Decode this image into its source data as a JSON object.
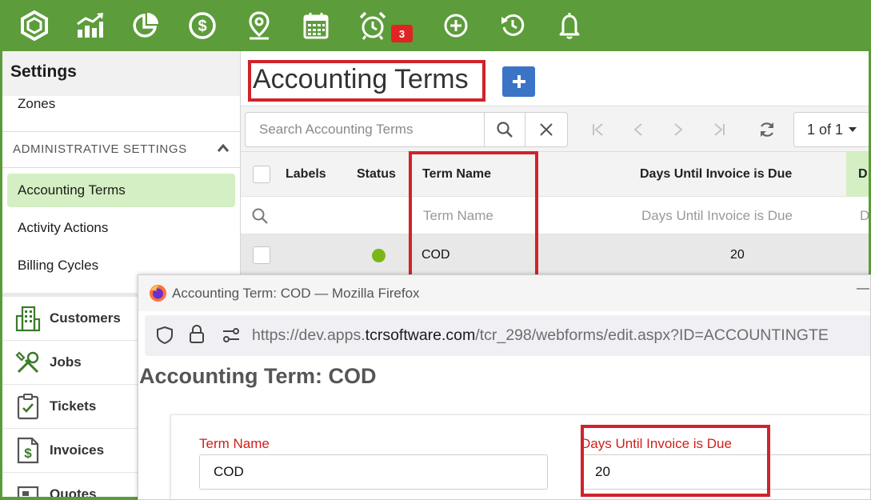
{
  "topbar": {
    "icons": [
      "app-logo-icon",
      "chart-icon",
      "pie-chart-icon",
      "dollar-icon",
      "map-pin-icon",
      "calendar-icon",
      "alarm-clock-icon",
      "add-circle-icon",
      "history-icon",
      "bell-icon"
    ],
    "alarm_badge": "3",
    "color": "#5c9c3a"
  },
  "sidebar": {
    "title": "Settings",
    "zones_label": "Zones",
    "section_label": "ADMINISTRATIVE SETTINGS",
    "items": [
      {
        "label": "Accounting Terms",
        "active": true
      },
      {
        "label": "Activity Actions",
        "active": false
      },
      {
        "label": "Billing Cycles",
        "active": false
      }
    ],
    "nav": [
      {
        "label": "Customers",
        "icon": "building-icon"
      },
      {
        "label": "Jobs",
        "icon": "tools-icon"
      },
      {
        "label": "Tickets",
        "icon": "clipboard-check-icon"
      },
      {
        "label": "Invoices",
        "icon": "invoice-dollar-icon"
      },
      {
        "label": "Quotes",
        "icon": "quote-icon"
      }
    ],
    "active_color": "#d4efc3"
  },
  "main": {
    "title": "Accounting Terms",
    "add_button_label": "+",
    "search": {
      "placeholder": "Search Accounting Terms"
    },
    "pager": {
      "label": "1 of 1"
    },
    "columns": {
      "labels": "Labels",
      "status": "Status",
      "term_name": "Term Name",
      "days_due": "Days Until Invoice is Due",
      "next": "D"
    },
    "filters": {
      "term_name": "Term Name",
      "days_due": "Days Until Invoice is Due",
      "next": "D"
    },
    "rows": [
      {
        "term_name": "COD",
        "days_due": "20",
        "status_color": "#7cb518"
      }
    ],
    "accent_color": "#3b74c7"
  },
  "popup": {
    "window_title": "Accounting Term: COD — Mozilla Firefox",
    "url_prefix": "https://dev.apps.",
    "url_domain": "tcrsoftware.com",
    "url_path": "/tcr_298/webforms/edit.aspx?ID=ACCOUNTINGTE",
    "heading": "Accounting Term: COD",
    "fields": {
      "term_name": {
        "label": "Term Name",
        "value": "COD"
      },
      "days_due": {
        "label": "Days Until Invoice is Due",
        "value": "20"
      }
    },
    "label_color": "#d0201a",
    "minimize_symbol": "—"
  },
  "highlight_color": "#d0232b"
}
